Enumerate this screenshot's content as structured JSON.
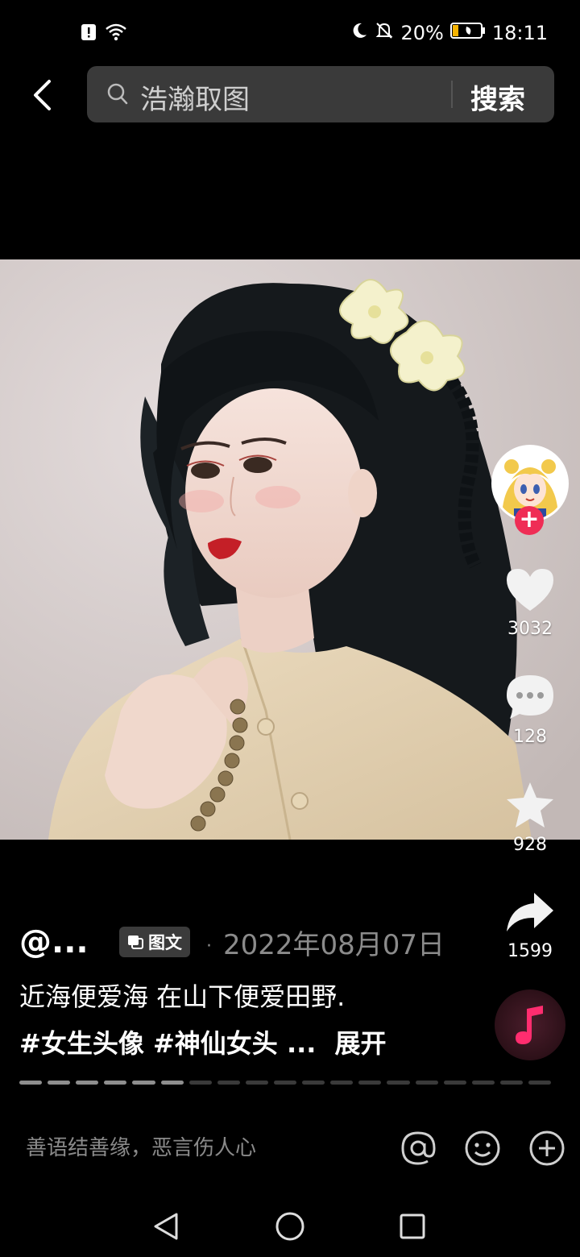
{
  "status_bar": {
    "battery": "20%",
    "time": "18:11"
  },
  "search": {
    "query": "浩瀚取图",
    "button_label": "搜索"
  },
  "post": {
    "author": "@...",
    "type_badge": "图文",
    "date": "2022年08月07日",
    "caption_line1": "近海便爱海 在山下便爱田野.",
    "hashtag1": "#女生头像",
    "hashtag2": "#神仙女头",
    "ellipsis": "...",
    "expand_label": "展开",
    "image_count": 19,
    "current_image": 6
  },
  "actions": {
    "likes": "3032",
    "comments": "128",
    "favorites": "928",
    "shares": "1599"
  },
  "comment_bar": {
    "placeholder": "善语结善缘，恶言伤人心"
  },
  "colors": {
    "accent_red": "#ef2d55",
    "background": "#000000"
  },
  "icons": [
    "back-arrow-icon",
    "search-icon",
    "heart-icon",
    "comment-icon",
    "star-icon",
    "share-icon",
    "music-note-icon",
    "at-icon",
    "emoji-icon",
    "plus-circle-icon"
  ]
}
